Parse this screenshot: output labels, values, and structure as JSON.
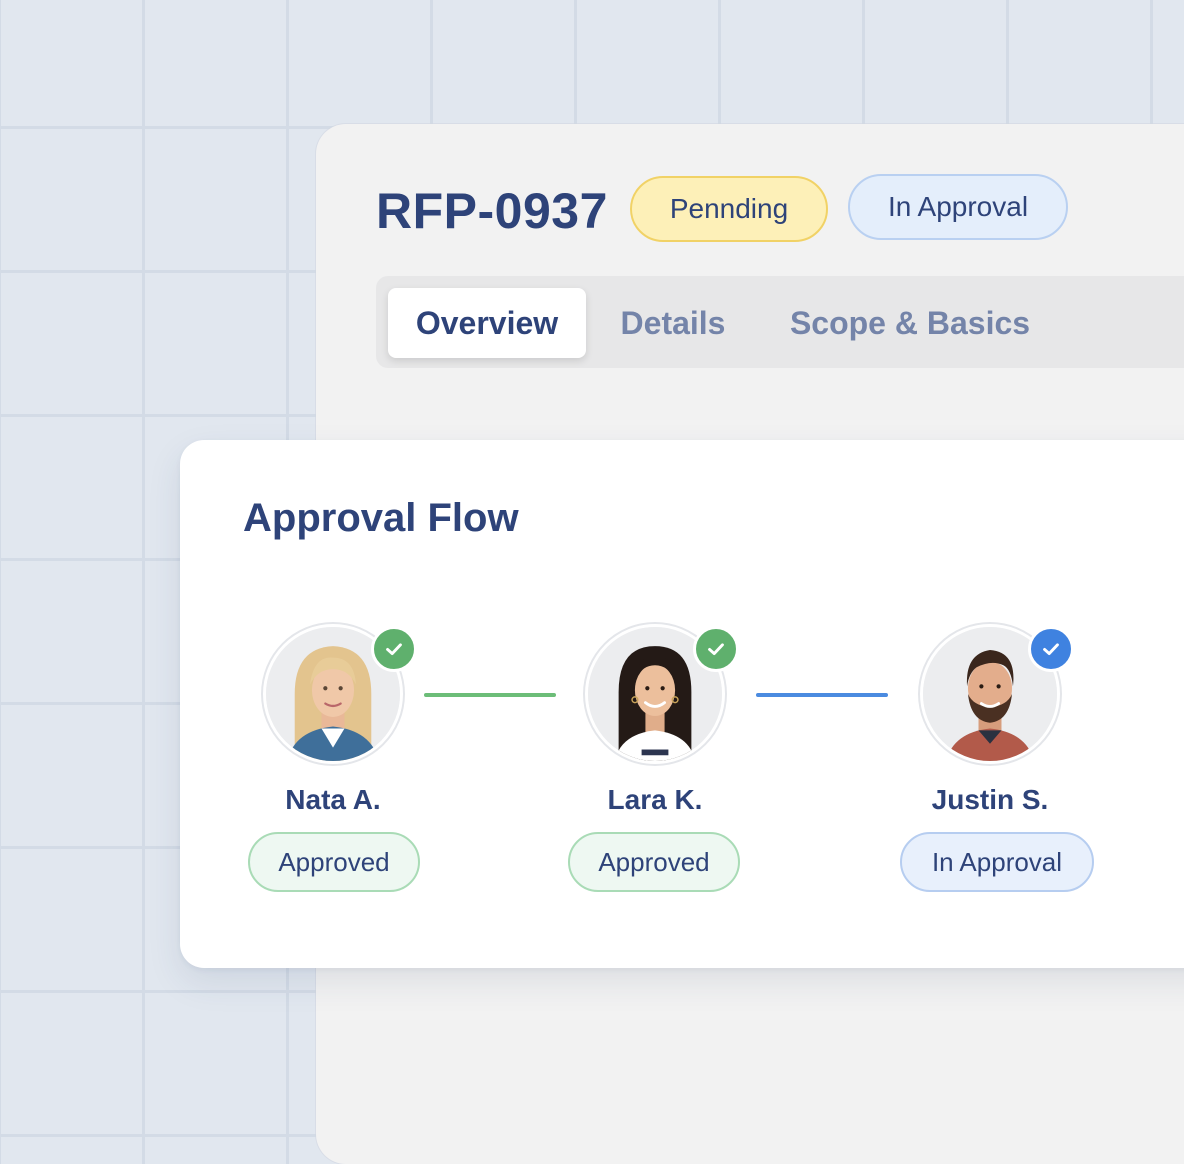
{
  "header": {
    "rfp_id": "RFP-0937",
    "badges": [
      {
        "label": "Pennding",
        "color": "#fdf0b8"
      },
      {
        "label": "In Approval",
        "color": "#e4eefb"
      }
    ]
  },
  "tabs": [
    {
      "label": "Overview",
      "active": true
    },
    {
      "label": "Details",
      "active": false
    },
    {
      "label": "Scope & Basics",
      "active": false
    }
  ],
  "approval_flow": {
    "title": "Approval Flow",
    "approvers": [
      {
        "name": "Nata A.",
        "status": "Approved",
        "check_color": "#5fb06d",
        "avatar_icon": "woman-blonde-avatar"
      },
      {
        "name": "Lara K.",
        "status": "Approved",
        "check_color": "#5fb06d",
        "avatar_icon": "woman-dark-hair-avatar"
      },
      {
        "name": "Justin S.",
        "status": "In Approval",
        "check_color": "#3f82e0",
        "avatar_icon": "man-beard-avatar"
      }
    ],
    "connector_colors": [
      "#6cbd78",
      "#4b8be0"
    ]
  },
  "colors": {
    "primary_text": "#2e4379",
    "muted_text": "#7484a9",
    "approved_green": "#5fb06d",
    "in_approval_blue": "#3f82e0"
  }
}
